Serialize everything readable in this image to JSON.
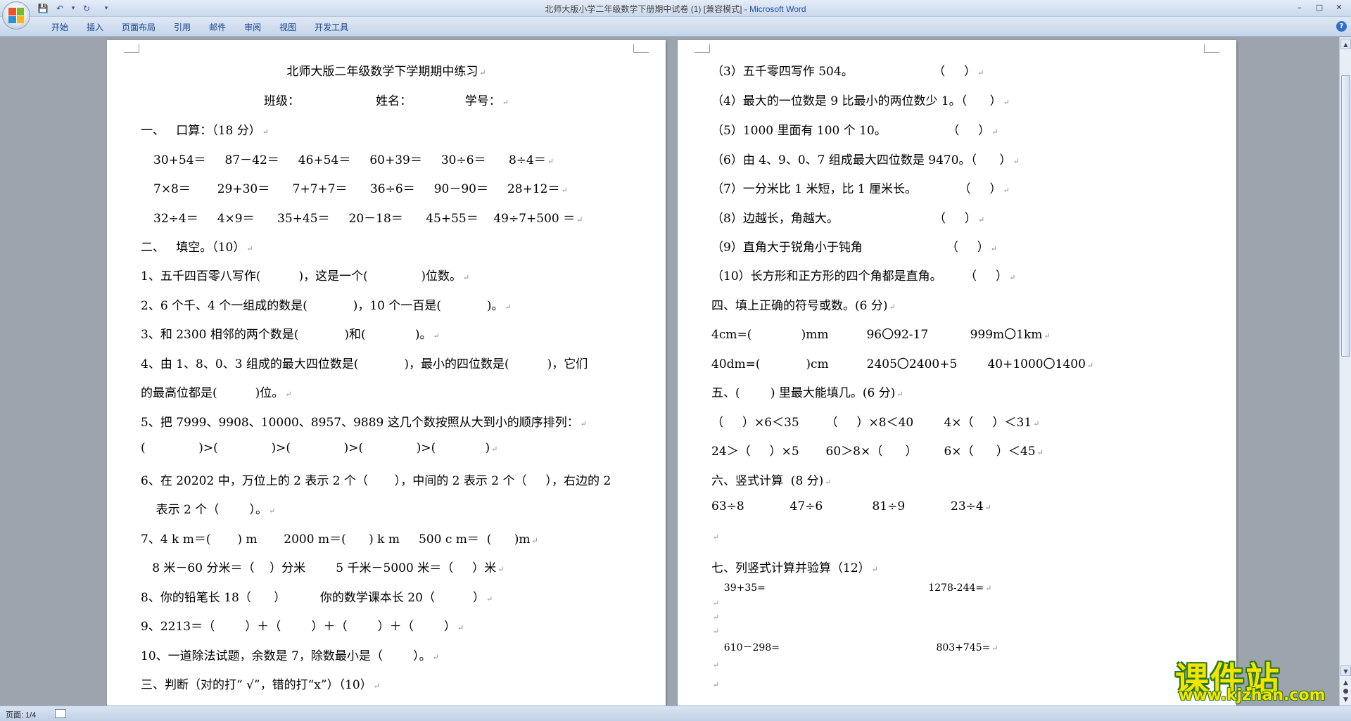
{
  "window": {
    "title": "北师大版小学二年级数学下册期中试卷 (1) [兼容模式] - ",
    "app_name": "Microsoft Word",
    "controls": [
      "–",
      "□",
      "✕"
    ]
  },
  "qat": {
    "save": "💾",
    "undo": "↶",
    "undo_drop": "▾",
    "redo": "↻",
    "customize": "▾"
  },
  "ribbon": {
    "tabs": [
      "开始",
      "插入",
      "页面布局",
      "引用",
      "邮件",
      "审阅",
      "视图",
      "开发工具"
    ],
    "help": "?"
  },
  "para_mark": "↵",
  "page1": {
    "title": "北师大版二年级数学下学期期中练习",
    "info": "班级：                    姓名：              学号：",
    "s1_heading": "一、   口算：（18 分）",
    "oral": [
      "30+54＝     87－42＝     46+54＝     60+39＝     30÷6＝      8÷4＝",
      "7×8＝       29+30＝      7+7+7＝      36÷6＝     90－90＝     28+12＝",
      "32÷4＝     4×9＝      35+45＝     20－18＝      45+55＝    49÷7+500 ＝"
    ],
    "s2_heading": "二、   填空。（10）",
    "fill": [
      "1、五千四百零八写作(          )，这是一个(              )位数。",
      "2、6 个千、4 个一组成的数是(            )，10 个一百是(            )。",
      "3、和 2300 相邻的两个数是(            )和(             )。",
      "4、由 1、8、0、3 组成的最大四位数是(            )，最小的四位数是(          )，它们",
      "的最高位都是(          )位。",
      "5、把 7999、9908、10000、8957、9889 这几个数按照从大到小的顺序排列：",
      "(              )>(              )>(              )>(              )>(             )",
      "6、在 20202 中，万位上的 2 表示 2 个（       ），中间的 2 表示 2 个（     ），右边的 2",
      "    表示 2 个（        ）。",
      "7、4 k m＝(       ) m       2000 m＝(      ) k m     500 c m＝  (      )m",
      "   8 米－60 分米＝（    ）分米        5 千米－5000 米＝（     ）米",
      "8、你的铅笔长 18（      ）         你的数学课本长 20（          ）",
      "9、2213＝（        ）＋（        ）＋（        ）＋（        ）",
      "10、一道除法试题，余数是 7，除数最小是（        ）。"
    ],
    "s3_heading": "三、判断（对的打“ √”，错的打“x”）（10）"
  },
  "page2": {
    "judge": [
      "（3）五千零四写作 504。                     （     ）",
      "（4）最大的一位数是 9 比最小的两位数少 1。（      ）",
      "（5）1000 里面有 100 个 10。                （     ）",
      "（6）由 4、9、0、7 组成最大四位数是 9470。（      ）",
      "（7）一分米比 1 米短，比 1 厘米长。           （     ）",
      "（8）边越长，角越大。                         （     ）",
      "（9）直角大于锐角小于钝角                      （     ）",
      "（10）长方形和正方形的四个角都是直角。      （     ）"
    ],
    "s4_heading": "四、填上正确的符号或数。(6 分)",
    "symbols": [
      "4cm=(             )mm          96〇92-17           999m〇1km",
      "40dm=(            )cm          2405〇2400+5        40+1000〇1400"
    ],
    "s5_heading": "五、(        ) 里最大能填几。(6 分)",
    "maxfill": [
      "（     ）×6＜35       （     ）×8＜40        4×（     ）＜31",
      "24＞（     ）×5       60＞8×（      ）       6×（      ）＜45"
    ],
    "s6_heading": "六、竖式计算  (8 分)",
    "vertical": "63÷8            47÷6             81÷9            23÷4",
    "s7_heading": "七、列竖式计算并验算（12）",
    "check1": "    39+35=                                                    1278-244=",
    "check2": "    610－298=                                                  803+745="
  },
  "status": {
    "page": "页面: 1/4"
  },
  "watermark": {
    "title": "课件站",
    "url": "www.kjzhan.com"
  }
}
